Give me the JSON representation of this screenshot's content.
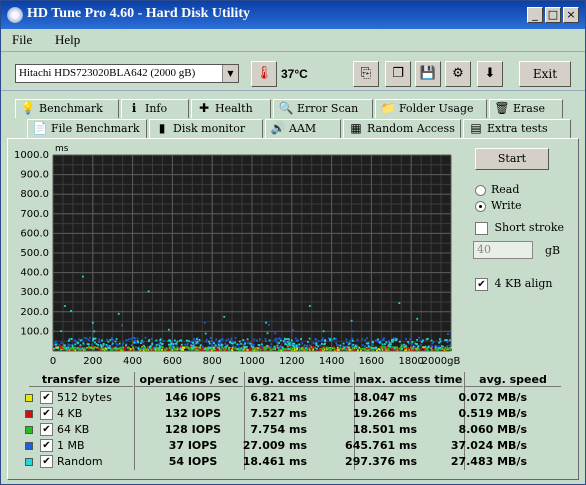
{
  "window": {
    "title": "HD Tune Pro 4.60 - Hard Disk Utility"
  },
  "titlebar_buttons": [
    "_",
    "□",
    "×"
  ],
  "menu": [
    "File",
    "Help"
  ],
  "toolbar": {
    "drive": "Hitachi HDS723020BLA642 (2000 gB)",
    "temperature": "37",
    "temperature_unit": "°C",
    "exit_label": "Exit"
  },
  "tabs_top": [
    {
      "label": "Benchmark",
      "icon": "lightbulb-icon",
      "glyph": "💡"
    },
    {
      "label": "Info",
      "icon": "info-icon",
      "glyph": "ℹ"
    },
    {
      "label": "Health",
      "icon": "health-cross-icon",
      "glyph": "✚"
    },
    {
      "label": "Error Scan",
      "icon": "magnifier-icon",
      "glyph": "🔍"
    },
    {
      "label": "Folder Usage",
      "icon": "folder-icon",
      "glyph": "📁"
    },
    {
      "label": "Erase",
      "icon": "trash-icon",
      "glyph": "🗑"
    }
  ],
  "tabs_bottom": [
    {
      "label": "File Benchmark",
      "icon": "file-icon",
      "glyph": "📄"
    },
    {
      "label": "Disk monitor",
      "icon": "bar-chart-icon",
      "glyph": "▮"
    },
    {
      "label": "AAM",
      "icon": "speaker-icon",
      "glyph": "🔊"
    },
    {
      "label": "Random Access",
      "icon": "grid-icon",
      "glyph": "▦"
    },
    {
      "label": "Extra tests",
      "icon": "table-icon",
      "glyph": "▤"
    }
  ],
  "active_tab": "Random Access",
  "controls": {
    "start_label": "Start",
    "read_label": "Read",
    "write_label": "Write",
    "selected_mode": "Write",
    "short_stroke_label": "Short stroke",
    "short_stroke_checked": false,
    "stroke_value": "40",
    "stroke_unit": "gB",
    "align_label": "4 KB align",
    "align_checked": true
  },
  "chart_data": {
    "type": "scatter",
    "ylabel": "ms",
    "xlabel": "",
    "x_unit_suffix": "gB",
    "ylim": [
      0,
      1000
    ],
    "xlim": [
      0,
      2000
    ],
    "y_ticks": [
      "1000.0",
      "900.0",
      "800.0",
      "700.0",
      "600.0",
      "500.0",
      "400.0",
      "300.0",
      "200.0",
      "100.0"
    ],
    "x_ticks": [
      "0",
      "200",
      "400",
      "600",
      "800",
      "1000",
      "1200",
      "1400",
      "1600",
      "1800",
      "2000"
    ],
    "grid": true,
    "background": "#1e1e1e",
    "series": [
      {
        "name": "512 bytes",
        "color": "#e8e800",
        "access_ms_avg": 6.821,
        "access_ms_max": 18.047
      },
      {
        "name": "4 KB",
        "color": "#d01010",
        "access_ms_avg": 7.527,
        "access_ms_max": 19.266
      },
      {
        "name": "64 KB",
        "color": "#20c020",
        "access_ms_avg": 7.754,
        "access_ms_max": 18.501
      },
      {
        "name": "1 MB",
        "color": "#2060e0",
        "access_ms_avg": 27.009,
        "access_ms_max": 645.761
      },
      {
        "name": "Random",
        "color": "#20d8d8",
        "access_ms_avg": 18.461,
        "access_ms_max": 297.376
      }
    ],
    "outliers": [
      {
        "x": 150,
        "y": 380
      },
      {
        "x": 480,
        "y": 305
      },
      {
        "x": 1740,
        "y": 245
      },
      {
        "x": 60,
        "y": 230
      },
      {
        "x": 90,
        "y": 205
      },
      {
        "x": 860,
        "y": 175
      },
      {
        "x": 1290,
        "y": 230
      },
      {
        "x": 330,
        "y": 190
      },
      {
        "x": 1500,
        "y": 155
      },
      {
        "x": 1830,
        "y": 165
      },
      {
        "x": 1070,
        "y": 145
      },
      {
        "x": 200,
        "y": 145
      }
    ]
  },
  "table": {
    "headers": [
      "transfer size",
      "operations / sec",
      "avg. access time",
      "max. access time",
      "avg. speed"
    ],
    "rows": [
      {
        "size": "512 bytes",
        "color": "#e8e800",
        "checked": true,
        "ops": "146 IOPS",
        "avg": "6.821 ms",
        "max": "18.047 ms",
        "speed": "0.072 MB/s"
      },
      {
        "size": "4 KB",
        "color": "#d01010",
        "checked": true,
        "ops": "132 IOPS",
        "avg": "7.527 ms",
        "max": "19.266 ms",
        "speed": "0.519 MB/s"
      },
      {
        "size": "64 KB",
        "color": "#20c020",
        "checked": true,
        "ops": "128 IOPS",
        "avg": "7.754 ms",
        "max": "18.501 ms",
        "speed": "8.060 MB/s"
      },
      {
        "size": "1 MB",
        "color": "#2060e0",
        "checked": true,
        "ops": "37 IOPS",
        "avg": "27.009 ms",
        "max": "645.761 ms",
        "speed": "37.024 MB/s"
      },
      {
        "size": "Random",
        "color": "#20d8d8",
        "checked": true,
        "ops": "54 IOPS",
        "avg": "18.461 ms",
        "max": "297.376 ms",
        "speed": "27.483 MB/s"
      }
    ]
  }
}
